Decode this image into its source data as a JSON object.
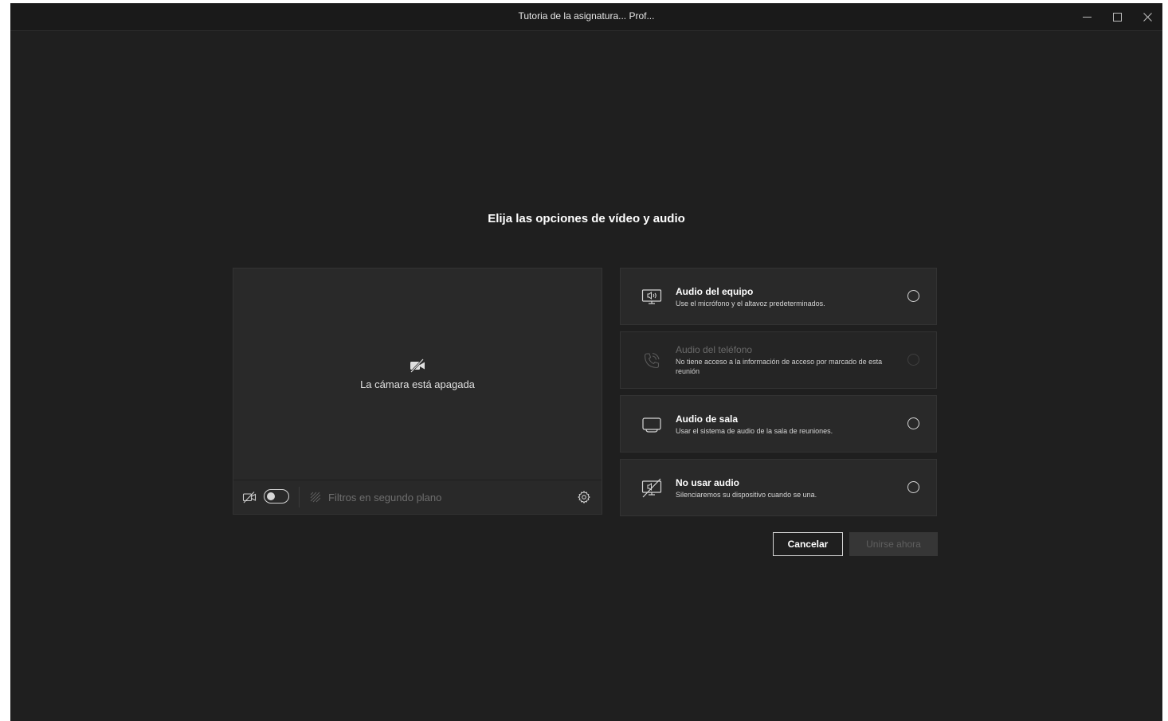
{
  "window": {
    "title": "Tutoria de la asignatura... Prof...",
    "controls": [
      "minimize-icon",
      "maximize-icon",
      "close-icon"
    ]
  },
  "heading": "Elija las opciones de vídeo y audio",
  "preview": {
    "camera_off_text": "La cámara está apagada",
    "camera_toggle_on": false,
    "background_filters_label": "Filtros en segundo plano"
  },
  "audio_options": [
    {
      "id": "computer",
      "icon": "computer-audio-icon",
      "title": "Audio del equipo",
      "description": "Use el micrófono y el altavoz predeterminados.",
      "enabled": true
    },
    {
      "id": "phone",
      "icon": "phone-audio-icon",
      "title": "Audio del teléfono",
      "description": "No tiene acceso a la información de acceso por marcado de esta reunión",
      "enabled": false
    },
    {
      "id": "room",
      "icon": "room-audio-icon",
      "title": "Audio de sala",
      "description": "Usar el sistema de audio de la sala de reuniones.",
      "enabled": true
    },
    {
      "id": "none",
      "icon": "no-audio-icon",
      "title": "No usar audio",
      "description": "Silenciaremos su dispositivo cuando se una.",
      "enabled": true
    }
  ],
  "buttons": {
    "cancel": "Cancelar",
    "join": "Unirse ahora"
  },
  "colors": {
    "background": "#1f1f1f",
    "panel": "#292929",
    "text": "#ffffff",
    "muted": "#6e6e6e"
  }
}
